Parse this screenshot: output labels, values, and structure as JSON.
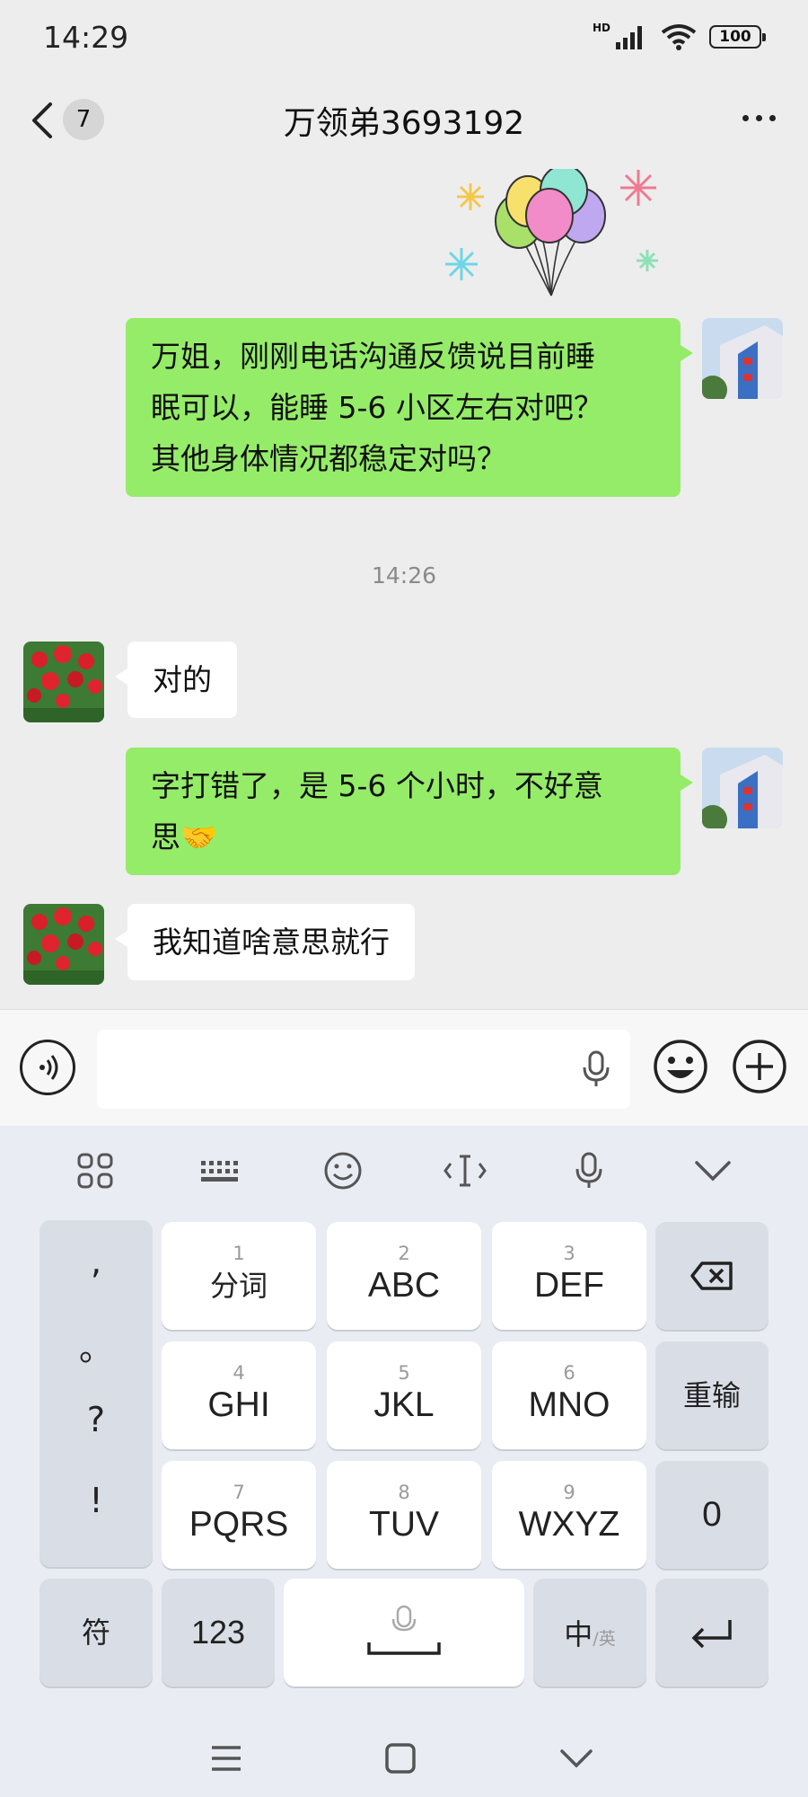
{
  "status": {
    "time": "14:29",
    "hd": "HD",
    "battery": "100"
  },
  "header": {
    "unread_count": "7",
    "title": "万领弟3693192"
  },
  "messages": {
    "m1": {
      "lines": [
        "万姐，刚刚电话沟通反馈说目前睡",
        "眠可以，能睡 5-6 小区左右对吧？",
        "其他身体情况都稳定对吗？"
      ]
    },
    "timestamp": "14:26",
    "m2": {
      "text": "对的"
    },
    "m3": {
      "lines": [
        "字打错了，是 5-6 个小时，不好意",
        "思🤝"
      ]
    },
    "m4": {
      "text": "我知道啥意思就行"
    }
  },
  "keyboard": {
    "punct": [
      ",",
      "。",
      "?",
      "!"
    ],
    "keys": [
      {
        "num": "1",
        "label": "分词"
      },
      {
        "num": "2",
        "label": "ABC"
      },
      {
        "num": "3",
        "label": "DEF"
      },
      {
        "num": "4",
        "label": "GHI"
      },
      {
        "num": "5",
        "label": "JKL"
      },
      {
        "num": "6",
        "label": "MNO"
      },
      {
        "num": "7",
        "label": "PQRS"
      },
      {
        "num": "8",
        "label": "TUV"
      },
      {
        "num": "9",
        "label": "WXYZ"
      }
    ],
    "reinput": "重输",
    "zero": "0",
    "symbols": "符",
    "num123": "123",
    "lang_main": "中",
    "lang_sub": "/英"
  },
  "colors": {
    "sent_bubble": "#95ec69",
    "received_bubble": "#ffffff",
    "chat_bg": "#ededed",
    "keyboard_bg": "#e9ecf2"
  }
}
